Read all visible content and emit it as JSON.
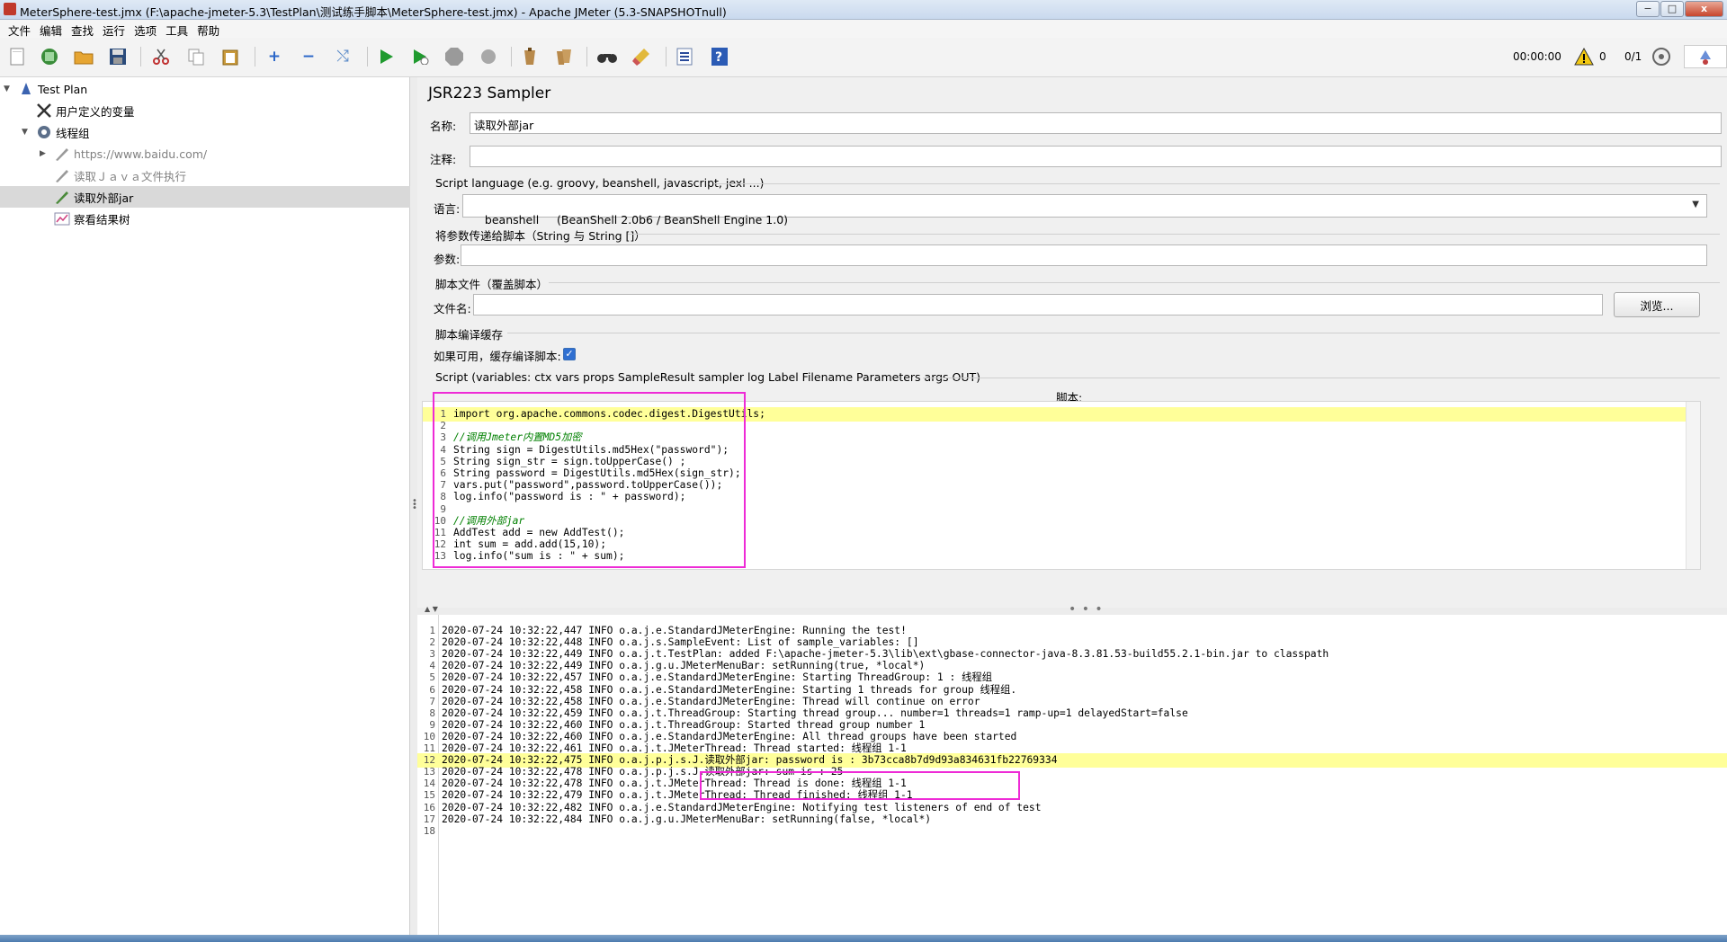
{
  "window": {
    "title": "MeterSphere-test.jmx (F:\\apache-jmeter-5.3\\TestPlan\\测试练手脚本\\MeterSphere-test.jmx) - Apache JMeter (5.3-SNAPSHOTnull)",
    "minimize": "−",
    "maximize": "□",
    "close": "x"
  },
  "menu": [
    "文件",
    "编辑",
    "查找",
    "运行",
    "选项",
    "工具",
    "帮助"
  ],
  "toolbar": {
    "icons": [
      "new-icon",
      "templates-icon",
      "open-icon",
      "save-icon",
      "cut-icon",
      "copy-icon",
      "paste-icon",
      "expand-icon",
      "collapse-icon",
      "toggle-icon",
      "start-icon",
      "start-no-timers-icon",
      "stop-icon",
      "shutdown-icon",
      "clear-icon",
      "clear-all-icon",
      "search-icon",
      "reset-search-icon",
      "function-helper-icon",
      "help-icon"
    ],
    "timer": "00:00:00",
    "warnings": "0",
    "threads": "0/1"
  },
  "tree": {
    "items": [
      {
        "label": "Test Plan",
        "icon": "test-plan-icon"
      },
      {
        "label": "用户定义的变量",
        "icon": "tools-icon"
      },
      {
        "label": "线程组",
        "icon": "gear-icon"
      },
      {
        "label": "https://www.baidu.com/",
        "icon": "pencil-icon"
      },
      {
        "label": "读取Ｊａｖａ文件执行",
        "icon": "pencil-icon"
      },
      {
        "label": "读取外部jar",
        "icon": "pencil-icon"
      },
      {
        "label": "察看结果树",
        "icon": "chart-icon"
      }
    ]
  },
  "sampler": {
    "title": "JSR223 Sampler",
    "name_label": "名称:",
    "name_value": "读取外部jar",
    "comment_label": "注释:",
    "comment_value": "",
    "script_language_section": "Script language (e.g. groovy, beanshell, javascript, jexl ...)",
    "language_label": "语言:",
    "language_value": "beanshell     (BeanShell 2.0b6 / BeanShell Engine 1.0)",
    "params_section": "将参数传递给脚本（String 与 String []）",
    "params_label": "参数:",
    "params_value": "",
    "file_section": "脚本文件（覆盖脚本）",
    "file_label": "文件名:",
    "file_value": "",
    "browse": "浏览...",
    "cache_section": "脚本编译缓存",
    "cache_label": "如果可用，缓存编译脚本:",
    "cache_checked": "✓",
    "script_section": "Script (variables: ctx vars props SampleResult sampler log Label Filename Parameters args OUT)",
    "script_label": "脚本:"
  },
  "script_lines": [
    "import org.apache.commons.codec.digest.DigestUtils;",
    "",
    "//调用Jmeter内置MD5加密",
    "String sign = DigestUtils.md5Hex(\"password\");",
    "String sign_str = sign.toUpperCase() ;",
    "String password = DigestUtils.md5Hex(sign_str);",
    "vars.put(\"password\",password.toUpperCase());",
    "log.info(\"password is : \" + password);",
    "",
    "//调用外部jar",
    "AddTest add = new AddTest();",
    "int sum = add.add(15,10);",
    "log.info(\"sum is : \" + sum);"
  ],
  "log_lines": [
    "2020-07-24 10:32:22,447 INFO o.a.j.e.StandardJMeterEngine: Running the test!",
    "2020-07-24 10:32:22,448 INFO o.a.j.s.SampleEvent: List of sample_variables: []",
    "2020-07-24 10:32:22,449 INFO o.a.j.t.TestPlan: added F:\\apache-jmeter-5.3\\lib\\ext\\gbase-connector-java-8.3.81.53-build55.2.1-bin.jar to classpath",
    "2020-07-24 10:32:22,449 INFO o.a.j.g.u.JMeterMenuBar: setRunning(true, *local*)",
    "2020-07-24 10:32:22,457 INFO o.a.j.e.StandardJMeterEngine: Starting ThreadGroup: 1 : 线程组",
    "2020-07-24 10:32:22,458 INFO o.a.j.e.StandardJMeterEngine: Starting 1 threads for group 线程组.",
    "2020-07-24 10:32:22,458 INFO o.a.j.e.StandardJMeterEngine: Thread will continue on error",
    "2020-07-24 10:32:22,459 INFO o.a.j.t.ThreadGroup: Starting thread group... number=1 threads=1 ramp-up=1 delayedStart=false",
    "2020-07-24 10:32:22,460 INFO o.a.j.t.ThreadGroup: Started thread group number 1",
    "2020-07-24 10:32:22,460 INFO o.a.j.e.StandardJMeterEngine: All thread groups have been started",
    "2020-07-24 10:32:22,461 INFO o.a.j.t.JMeterThread: Thread started: 线程组 1-1",
    "2020-07-24 10:32:22,475 INFO o.a.j.p.j.s.J.读取外部jar: password is : 3b73cca8b7d9d93a834631fb22769334",
    "2020-07-24 10:32:22,478 INFO o.a.j.p.j.s.J.读取外部jar: sum is : 25",
    "2020-07-24 10:32:22,478 INFO o.a.j.t.JMeterThread: Thread is done: 线程组 1-1",
    "2020-07-24 10:32:22,479 INFO o.a.j.t.JMeterThread: Thread finished: 线程组 1-1",
    "2020-07-24 10:32:22,482 INFO o.a.j.e.StandardJMeterEngine: Notifying test listeners of end of test",
    "2020-07-24 10:32:22,484 INFO o.a.j.g.u.JMeterMenuBar: setRunning(false, *local*)",
    ""
  ],
  "colors": {
    "highlight": "#ffff99",
    "annotation": "#ee2bd6",
    "selected_row": "#d9d9d9"
  }
}
